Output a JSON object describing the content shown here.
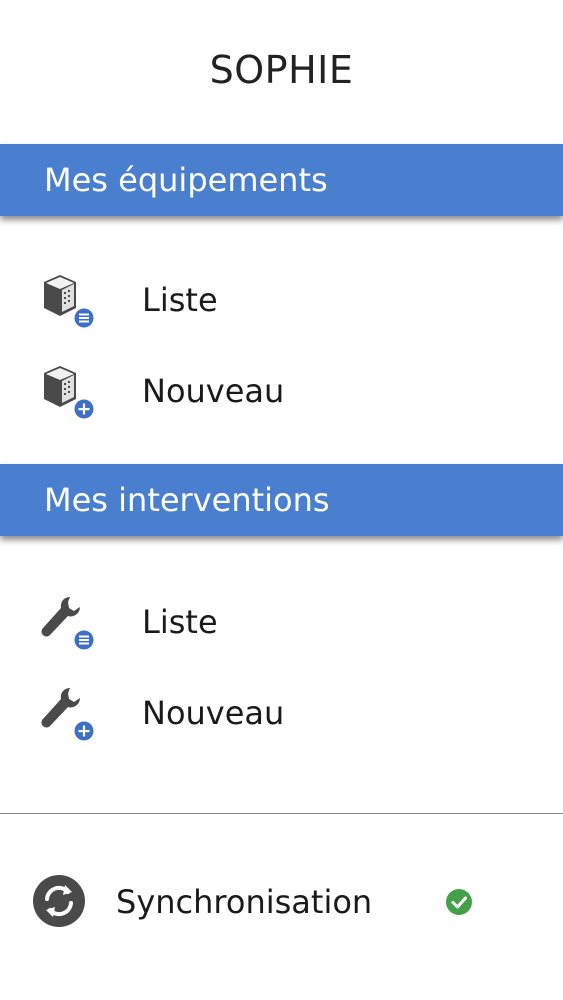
{
  "user": {
    "name": "SOPHIE"
  },
  "sections": [
    {
      "title": "Mes équipements",
      "items": [
        {
          "label": "Liste",
          "icon": "equipment-list-icon"
        },
        {
          "label": "Nouveau",
          "icon": "equipment-add-icon"
        }
      ]
    },
    {
      "title": "Mes interventions",
      "items": [
        {
          "label": "Liste",
          "icon": "wrench-list-icon"
        },
        {
          "label": "Nouveau",
          "icon": "wrench-add-icon"
        }
      ]
    }
  ],
  "sync": {
    "label": "Synchronisation",
    "icon": "sync-icon",
    "status_icon": "check-circle-icon",
    "status_color": "#43a047"
  },
  "colors": {
    "header_bg": "#4a7fcf",
    "icon_dark": "#4a4a4a",
    "icon_badge": "#3d6fc4"
  }
}
